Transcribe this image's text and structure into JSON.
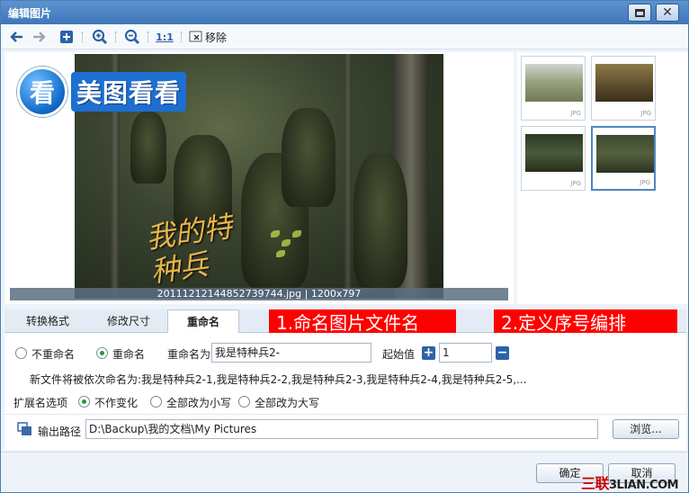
{
  "window": {
    "title": "编辑图片"
  },
  "toolbar": {
    "remove_label": "移除",
    "actual_size_label": "1:1"
  },
  "preview": {
    "logo_char": "看",
    "logo_text": "美图看看",
    "calligraphy": "我的特种兵",
    "caption": "20111212144852739744.jpg | 1200x797"
  },
  "thumbnails": {
    "format_label": "JPG"
  },
  "tabs": [
    {
      "label": "转换格式"
    },
    {
      "label": "修改尺寸"
    },
    {
      "label": "重命名"
    }
  ],
  "callouts": {
    "first": "1.命名图片文件名",
    "second": "2.定义序号编排"
  },
  "rename": {
    "no_rename_label": "不重命名",
    "rename_label": "重命名",
    "rename_as_label": "重命名为",
    "rename_value": "我是特种兵2-",
    "start_label": "起始值",
    "start_value": "1",
    "preview_text": "新文件将被依次命名为:我是特种兵2-1,我是特种兵2-2,我是特种兵2-3,我是特种兵2-4,我是特种兵2-5,..."
  },
  "extension": {
    "label": "扩展名选项",
    "no_change": "不作变化",
    "lower": "全部改为小写",
    "upper": "全部改为大写"
  },
  "output": {
    "label": "输出路径",
    "path": "D:\\Backup\\我的文档\\My Pictures",
    "browse_label": "浏览..."
  },
  "footer": {
    "ok_label": "确定",
    "cancel_label": "取消"
  },
  "watermark": {
    "brand": "三联",
    "domain": "3LIAN.COM"
  },
  "colors": {
    "accent": "#2c63a8",
    "callout": "#ff0000",
    "radio_selected": "#1a9d3a"
  }
}
